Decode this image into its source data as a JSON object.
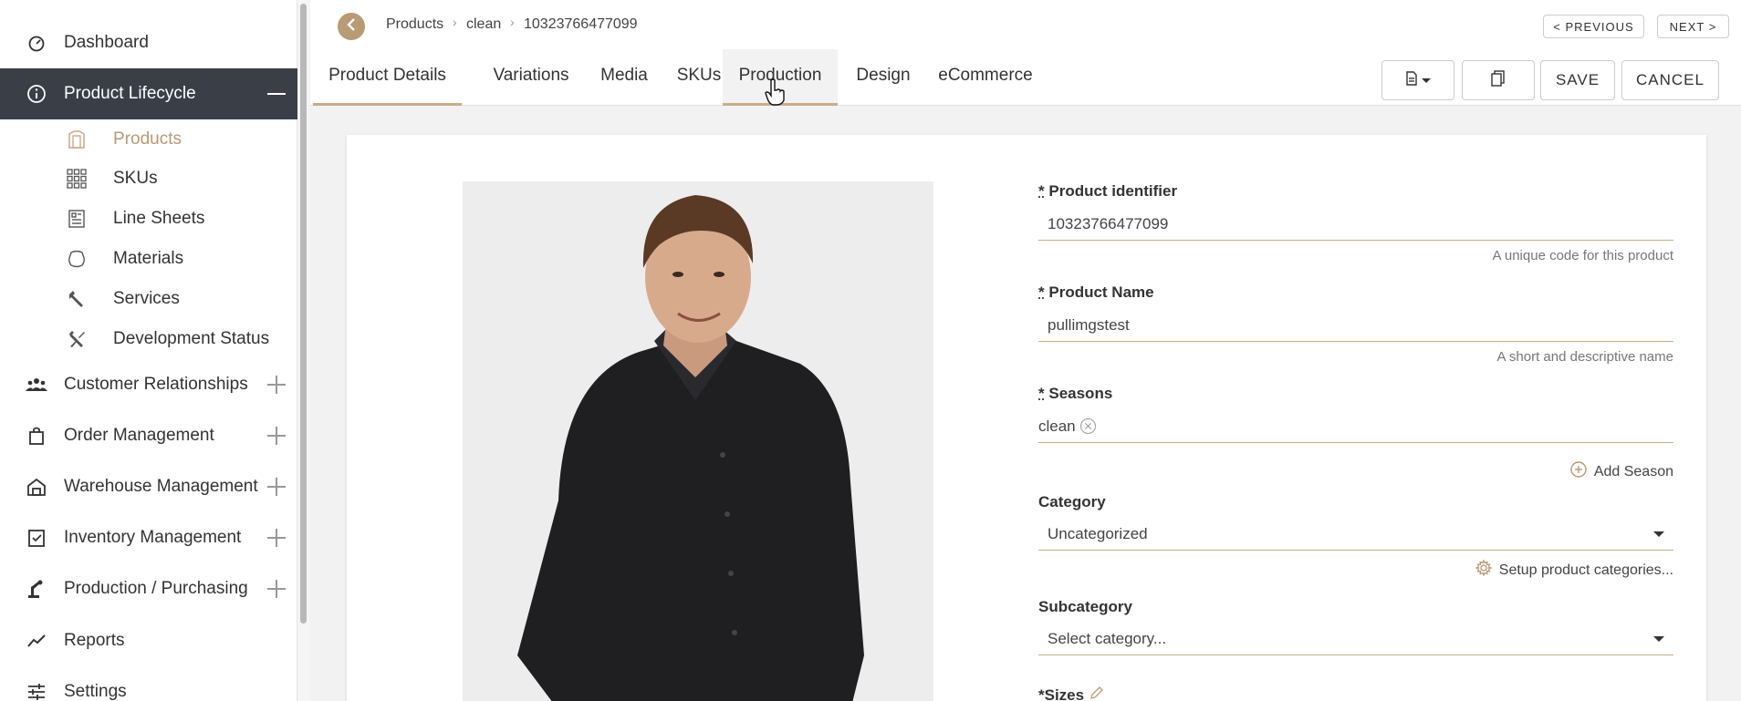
{
  "sidebar": {
    "items": [
      {
        "label": "Dashboard",
        "icon": "speedometer-icon"
      },
      {
        "label": "Product Lifecycle",
        "icon": "info-circle-icon"
      },
      {
        "label": "Customer Relationships",
        "icon": "people-icon"
      },
      {
        "label": "Order Management",
        "icon": "shopping-bag-icon"
      },
      {
        "label": "Warehouse Management",
        "icon": "warehouse-icon"
      },
      {
        "label": "Inventory Management",
        "icon": "clipboard-check-icon"
      },
      {
        "label": "Production / Purchasing",
        "icon": "robot-arm-icon"
      },
      {
        "label": "Reports",
        "icon": "trend-line-icon"
      },
      {
        "label": "Settings",
        "icon": "sliders-icon"
      }
    ],
    "sub_items": [
      {
        "label": "Products",
        "icon": "product-icon"
      },
      {
        "label": "SKUs",
        "icon": "grid-icon"
      },
      {
        "label": "Line Sheets",
        "icon": "line-sheet-icon"
      },
      {
        "label": "Materials",
        "icon": "materials-icon"
      },
      {
        "label": "Services",
        "icon": "wrench-icon"
      },
      {
        "label": "Development Status",
        "icon": "tools-icon"
      }
    ]
  },
  "breadcrumb": [
    "Products",
    "clean",
    "10323766477099"
  ],
  "pager": {
    "previous": "< PREVIOUS",
    "next": "NEXT >"
  },
  "tabs": [
    "Product Details",
    "Variations",
    "Media",
    "SKUs",
    "Production",
    "Design",
    "eCommerce"
  ],
  "toolbar": {
    "save": "SAVE",
    "cancel": "CANCEL"
  },
  "form": {
    "identifier": {
      "label": "Product identifier",
      "value": "10323766477099",
      "hint": "A unique code for this product"
    },
    "name": {
      "label": "Product Name",
      "value": "pullimgstest",
      "hint": "A short and descriptive name"
    },
    "seasons": {
      "label": "Seasons",
      "chip": "clean",
      "add": "Add Season"
    },
    "category": {
      "label": "Category",
      "value": "Uncategorized",
      "setup": "Setup product categories..."
    },
    "subcategory": {
      "label": "Subcategory",
      "placeholder": "Select category..."
    },
    "sizes": {
      "label": "*Sizes"
    },
    "required_marker": "*"
  },
  "colors": {
    "accent": "#b89a75",
    "sidebar_active": "#3a3f47"
  }
}
